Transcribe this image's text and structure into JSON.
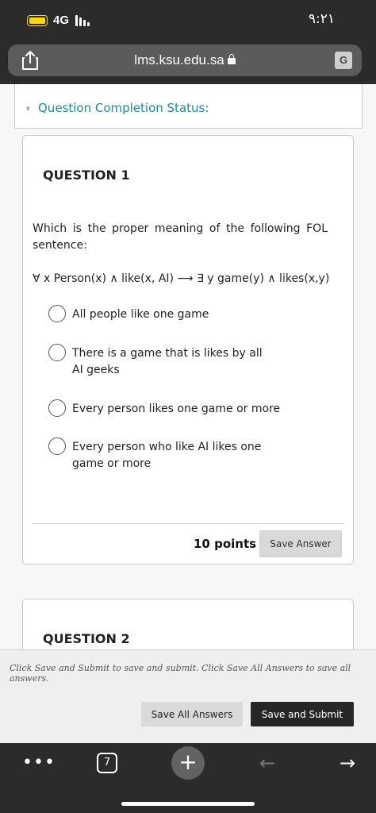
{
  "status_bar": {
    "network": "4G",
    "time": "٩:٢١",
    "battery_color": "#ffd60a"
  },
  "url_bar": {
    "domain": "lms.ksu.edu.sa",
    "share_icon": "share-icon",
    "translate_icon": "translate-icon",
    "translate_glyph": "G"
  },
  "completion_status": {
    "chevron": "»",
    "label": "Question Completion Status:"
  },
  "question1": {
    "title": "QUESTION 1",
    "text": "Which is the proper meaning of the following FOL sentence:",
    "formula": "∀ x Person(x) ∧ like(x, AI) ⟶ ∃ y game(y) ∧ likes(x,y)",
    "options": [
      {
        "label": "All people like one game"
      },
      {
        "label": "There is a game that is likes by all AI geeks"
      },
      {
        "label": "Every person likes one game or more"
      },
      {
        "label": "Every person who like AI likes one game or more"
      }
    ],
    "points": "10 points",
    "save_label": "Save Answer"
  },
  "question2": {
    "title": "QUESTION 2"
  },
  "footer": {
    "note": "Click Save and Submit to save and submit. Click Save All Answers to save all answers.",
    "save_all_label": "Save All Answers",
    "submit_label": "Save and Submit"
  },
  "toolbar": {
    "more_glyph": "•••",
    "tab_count": "7",
    "new_tab_glyph": "+",
    "back_glyph": "←",
    "forward_glyph": "→"
  },
  "colors": {
    "accent_teal": "#1f8a9b",
    "submit_bg": "#262626",
    "chrome_bg": "#2b2b2c"
  }
}
